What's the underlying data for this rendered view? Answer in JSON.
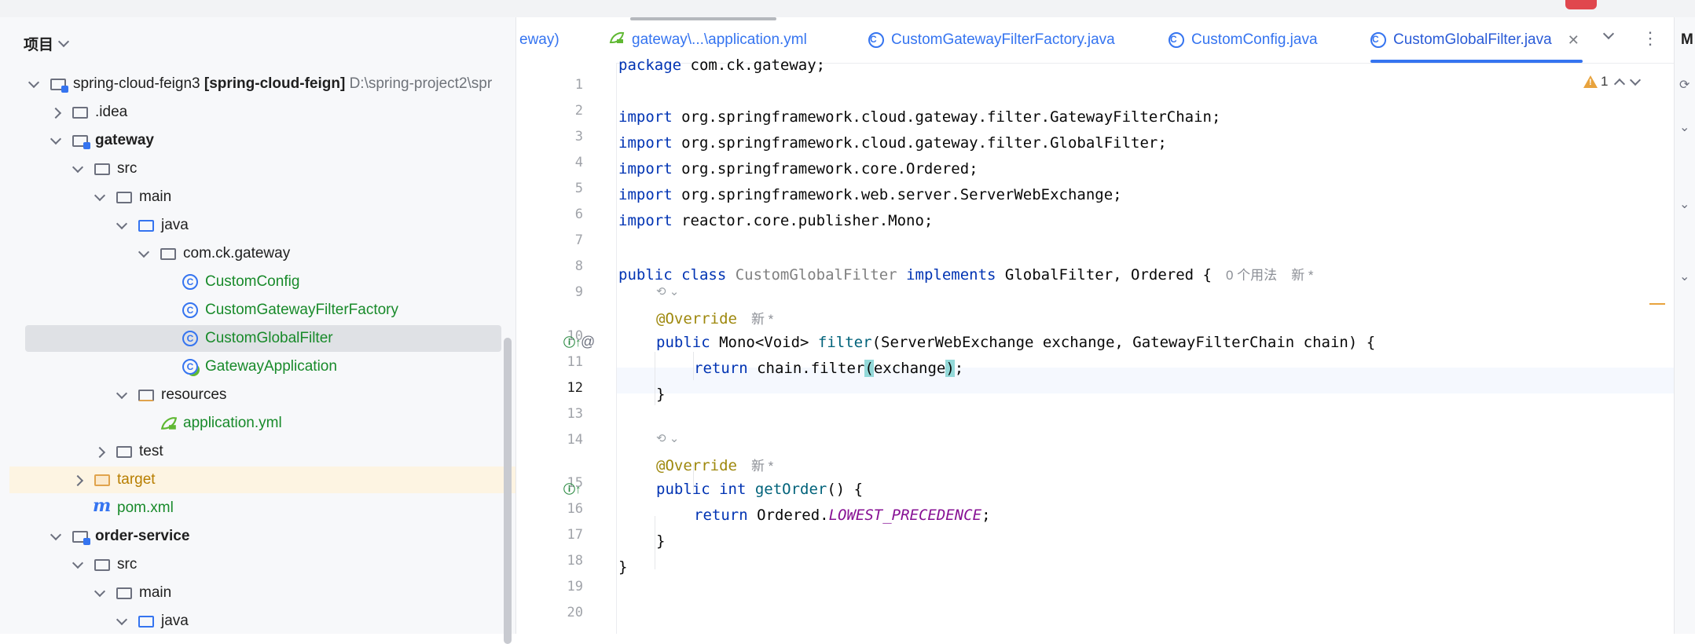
{
  "project_panel": {
    "title": "项目",
    "tree": [
      {
        "label": "spring-cloud-feign3",
        "module": "[spring-cloud-feign]",
        "path": "D:\\spring-project2\\spr",
        "level": 0,
        "expanded": true,
        "icon": "module-folder-icon"
      },
      {
        "label": ".idea",
        "level": 1,
        "expanded": false,
        "icon": "folder-icon"
      },
      {
        "label": "gateway",
        "level": 1,
        "expanded": true,
        "icon": "module-folder-icon",
        "bold": true
      },
      {
        "label": "src",
        "level": 2,
        "expanded": true,
        "icon": "folder-icon"
      },
      {
        "label": "main",
        "level": 3,
        "expanded": true,
        "icon": "folder-icon"
      },
      {
        "label": "java",
        "level": 4,
        "expanded": true,
        "icon": "source-folder-icon"
      },
      {
        "label": "com.ck.gateway",
        "level": 5,
        "expanded": true,
        "icon": "package-icon"
      },
      {
        "label": "CustomConfig",
        "level": 6,
        "icon": "class-icon",
        "color": "green"
      },
      {
        "label": "CustomGatewayFilterFactory",
        "level": 6,
        "icon": "class-icon",
        "color": "green"
      },
      {
        "label": "CustomGlobalFilter",
        "level": 6,
        "icon": "class-icon",
        "color": "green",
        "selected": true
      },
      {
        "label": "GatewayApplication",
        "level": 6,
        "icon": "spring-class-icon",
        "color": "green"
      },
      {
        "label": "resources",
        "level": 4,
        "expanded": true,
        "icon": "resources-folder-icon"
      },
      {
        "label": "application.yml",
        "level": 5,
        "icon": "yaml-icon",
        "color": "green"
      },
      {
        "label": "test",
        "level": 3,
        "expanded": false,
        "icon": "folder-icon"
      },
      {
        "label": "target",
        "level": 2,
        "expanded": false,
        "icon": "excluded-folder-icon",
        "color": "orange",
        "highlight": true
      },
      {
        "label": "pom.xml",
        "level": 2,
        "icon": "maven-icon",
        "color": "green"
      },
      {
        "label": "order-service",
        "level": 1,
        "expanded": true,
        "icon": "module-folder-icon",
        "bold": true
      },
      {
        "label": "src",
        "level": 2,
        "expanded": true,
        "icon": "folder-icon"
      },
      {
        "label": "main",
        "level": 3,
        "expanded": true,
        "icon": "folder-icon"
      },
      {
        "label": "java",
        "level": 4,
        "expanded": true,
        "icon": "source-folder-icon"
      }
    ]
  },
  "tabs": [
    {
      "label": "eway)",
      "icon": ""
    },
    {
      "label": "gateway\\...\\application.yml",
      "icon": "yaml-icon"
    },
    {
      "label": "CustomGatewayFilterFactory.java",
      "icon": "class-icon"
    },
    {
      "label": "CustomConfig.java",
      "icon": "class-icon"
    },
    {
      "label": "CustomGlobalFilter.java",
      "icon": "class-icon",
      "active": true,
      "close": "✕"
    }
  ],
  "editor": {
    "warnings": "1",
    "line_numbers": [
      "1",
      "2",
      "3",
      "4",
      "5",
      "6",
      "7",
      "8",
      "9",
      "10",
      "11",
      "12",
      "13",
      "14",
      "15",
      "16",
      "17",
      "18",
      "19",
      "20"
    ],
    "current_line": "12",
    "code": {
      "l1_kw": "package",
      "l1_rest": " com.ck.gateway;",
      "imp": "import",
      "l3_rest": " org.springframework.cloud.gateway.filter.GatewayFilterChain;",
      "l4_rest": " org.springframework.cloud.gateway.filter.GlobalFilter;",
      "l5_rest": " org.springframework.core.Ordered;",
      "l6_rest": " org.springframework.web.server.ServerWebExchange;",
      "l7_rest": " reactor.core.publisher.Mono;",
      "l9_kw": "public class",
      "l9_name": " CustomGlobalFilter ",
      "l9_impl": "implements",
      "l9_rest": " GlobalFilter, Ordered {",
      "l9_hint1": "0 个用法",
      "l9_hint2": "新 *",
      "override": "@Override",
      "new_hint": "新 *",
      "l11_kw": "public",
      "l11_type": " Mono<Void> ",
      "l11_fn": "filter",
      "l11_rest": "(ServerWebExchange exchange, GatewayFilterChain chain) {",
      "ret": "return",
      "l12_a": " chain.filter",
      "l12_p1": "(",
      "l12_b": "exchange",
      "l12_p2": ")",
      "l12_c": ";",
      "close_brace": "}",
      "l16_kw": "public int",
      "l16_fn": " getOrder",
      "l16_rest": "() {",
      "l17_a": " Ordered.",
      "l17_const": "LOWEST_PRECEDENCE",
      "l17_c": ";"
    }
  },
  "right_strip": {
    "label": "M"
  }
}
